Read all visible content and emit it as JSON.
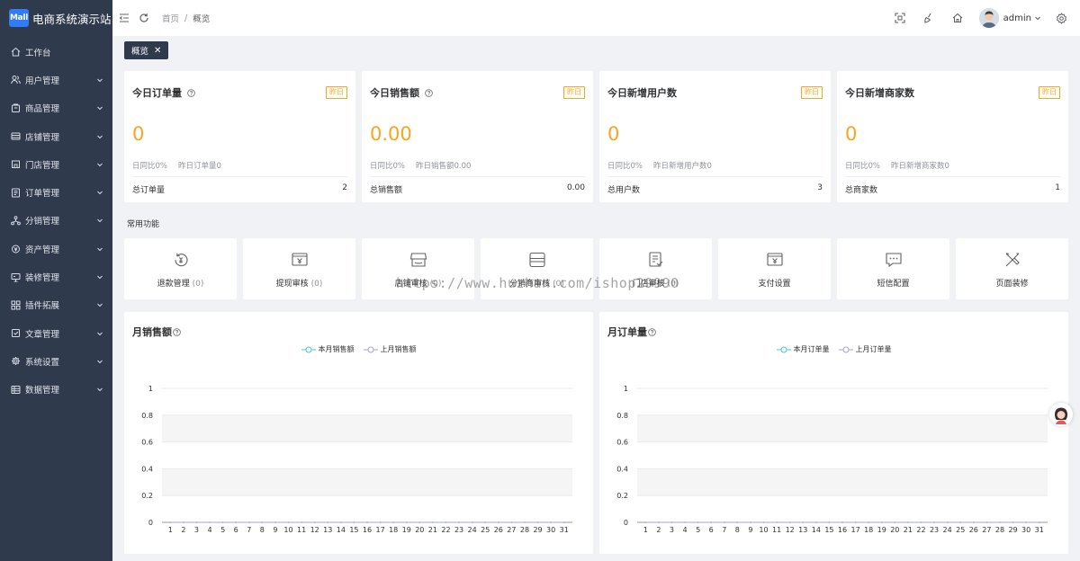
{
  "brand": {
    "logo_text": "Mall",
    "title": "电商系统演示站"
  },
  "sidebar": {
    "items": [
      {
        "label": "工作台",
        "icon": "home-icon",
        "has_arrow": false
      },
      {
        "label": "用户管理",
        "icon": "users-icon",
        "has_arrow": true
      },
      {
        "label": "商品管理",
        "icon": "goods-icon",
        "has_arrow": true
      },
      {
        "label": "店铺管理",
        "icon": "store-icon",
        "has_arrow": true
      },
      {
        "label": "门店管理",
        "icon": "shop-icon",
        "has_arrow": true
      },
      {
        "label": "订单管理",
        "icon": "order-icon",
        "has_arrow": true
      },
      {
        "label": "分销管理",
        "icon": "share-icon",
        "has_arrow": true
      },
      {
        "label": "资产管理",
        "icon": "asset-icon",
        "has_arrow": true
      },
      {
        "label": "装修管理",
        "icon": "monitor-icon",
        "has_arrow": true
      },
      {
        "label": "插件拓展",
        "icon": "grid-icon",
        "has_arrow": true
      },
      {
        "label": "文章管理",
        "icon": "article-icon",
        "has_arrow": true
      },
      {
        "label": "系统设置",
        "icon": "gear-icon",
        "has_arrow": true
      },
      {
        "label": "数据管理",
        "icon": "data-icon",
        "has_arrow": true
      }
    ]
  },
  "header": {
    "breadcrumb": {
      "home": "首页",
      "separator": "/",
      "current": "概览"
    },
    "user": {
      "name": "admin"
    }
  },
  "tags": [
    {
      "label": "概览",
      "close": "✕"
    }
  ],
  "stats": [
    {
      "title": "今日订单量",
      "has_help": true,
      "badge": "昨日",
      "value": "0",
      "sub_ratio": "日同比0%",
      "sub_yesterday": "昨日订单量0",
      "total_label": "总订单量",
      "total_value": "2"
    },
    {
      "title": "今日销售额",
      "has_help": true,
      "badge": "昨日",
      "value": "0.00",
      "sub_ratio": "日同比0%",
      "sub_yesterday": "昨日销售额0.00",
      "total_label": "总销售额",
      "total_value": "0.00"
    },
    {
      "title": "今日新增用户数",
      "has_help": false,
      "badge": "昨日",
      "value": "0",
      "sub_ratio": "日同比0%",
      "sub_yesterday": "昨日新增用户数0",
      "total_label": "总用户数",
      "total_value": "3"
    },
    {
      "title": "今日新增商家数",
      "has_help": false,
      "badge": "昨日",
      "value": "0",
      "sub_ratio": "日同比0%",
      "sub_yesterday": "昨日新增商家数0",
      "total_label": "总商家数",
      "total_value": "1"
    }
  ],
  "common_functions": {
    "label": "常用功能",
    "items": [
      {
        "label": "退款管理",
        "count": "(0)",
        "icon": "refund-icon"
      },
      {
        "label": "提现审核",
        "count": "(0)",
        "icon": "withdraw-icon"
      },
      {
        "label": "店铺审核",
        "count": "(0)",
        "icon": "store-audit-icon"
      },
      {
        "label": "分销商审核",
        "count": "(0)",
        "icon": "distributor-audit-icon"
      },
      {
        "label": "门店审核",
        "count": "(0)",
        "icon": "shop-audit-icon"
      },
      {
        "label": "支付设置",
        "count": "",
        "icon": "payment-icon"
      },
      {
        "label": "短信配置",
        "count": "",
        "icon": "sms-icon"
      },
      {
        "label": "页面装修",
        "count": "",
        "icon": "decorate-icon"
      }
    ]
  },
  "watermark": "https://www.huzhan.com/ishop29990",
  "colors": {
    "sidebar": "#2f3a4d",
    "accent_orange": "#f5a623",
    "series_current": "#4fc4c9",
    "series_last": "#a7a1d9"
  },
  "chart_data": [
    {
      "type": "line",
      "title": "月销售额",
      "x": [
        "1",
        "2",
        "3",
        "4",
        "5",
        "6",
        "7",
        "8",
        "9",
        "10",
        "11",
        "12",
        "13",
        "14",
        "15",
        "16",
        "17",
        "18",
        "19",
        "20",
        "21",
        "22",
        "23",
        "24",
        "25",
        "26",
        "27",
        "28",
        "29",
        "30",
        "31"
      ],
      "series": [
        {
          "name": "本月销售额",
          "values": [
            0,
            0,
            0,
            0,
            0,
            0,
            0,
            0,
            0,
            0,
            0,
            0,
            0,
            0,
            0,
            0,
            0,
            0,
            0,
            0,
            0,
            0,
            0,
            0,
            0,
            0,
            0,
            0,
            0,
            0,
            0
          ]
        },
        {
          "name": "上月销售额",
          "values": [
            0,
            0,
            0,
            0,
            0,
            0,
            0,
            0,
            0,
            0,
            0,
            0,
            0,
            0,
            0,
            0,
            0,
            0,
            0,
            0,
            0,
            0,
            0,
            0,
            0,
            0,
            0,
            0,
            0,
            0,
            0
          ]
        }
      ],
      "yticks": [
        "0",
        "0.2",
        "0.4",
        "0.6",
        "0.8",
        "1"
      ],
      "ylim": [
        0,
        1
      ],
      "legend": "top-center"
    },
    {
      "type": "line",
      "title": "月订单量",
      "x": [
        "1",
        "2",
        "3",
        "4",
        "5",
        "6",
        "7",
        "8",
        "9",
        "10",
        "11",
        "12",
        "13",
        "14",
        "15",
        "16",
        "17",
        "18",
        "19",
        "20",
        "21",
        "22",
        "23",
        "24",
        "25",
        "26",
        "27",
        "28",
        "29",
        "30",
        "31"
      ],
      "series": [
        {
          "name": "本月订单量",
          "values": [
            0,
            0,
            0,
            0,
            0,
            0,
            0,
            0,
            0,
            0,
            0,
            0,
            0,
            0,
            0,
            0,
            0,
            0,
            0,
            0,
            0,
            0,
            0,
            0,
            0,
            0,
            0,
            0,
            0,
            0,
            0
          ]
        },
        {
          "name": "上月订单量",
          "values": [
            0,
            0,
            0,
            0,
            0,
            0,
            0,
            0,
            0,
            0,
            0,
            0,
            0,
            0,
            0,
            0,
            0,
            0,
            0,
            0,
            0,
            0,
            0,
            0,
            0,
            0,
            0,
            0,
            0,
            0,
            0
          ]
        }
      ],
      "yticks": [
        "0",
        "0.2",
        "0.4",
        "0.6",
        "0.8",
        "1"
      ],
      "ylim": [
        0,
        1
      ],
      "legend": "top-center"
    }
  ]
}
